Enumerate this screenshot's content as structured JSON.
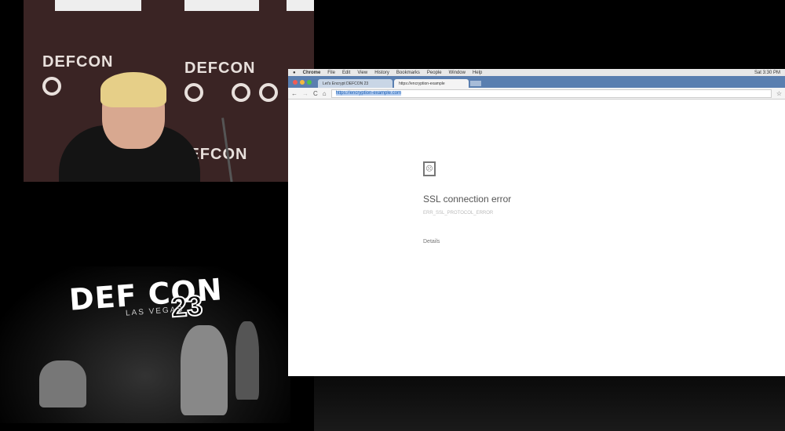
{
  "backdrop": {
    "word": "DEFCON"
  },
  "logo": {
    "title": "DEF CON",
    "number": "23",
    "subtitle": "LAS VEGAS"
  },
  "menubar": {
    "apple": "",
    "items": [
      "Chrome",
      "File",
      "Edit",
      "View",
      "History",
      "Bookmarks",
      "People",
      "Window",
      "Help"
    ],
    "clock": "Sat 3:30 PM"
  },
  "tabs": [
    {
      "label": "Let's Encrypt DEFCON 23"
    },
    {
      "label": "https://encryption-example"
    }
  ],
  "toolbar": {
    "back": "←",
    "forward": "→",
    "reload": "C",
    "home": "⌂",
    "url_scheme": "https://",
    "url_host": "encryption-example.com",
    "star": "☆"
  },
  "error": {
    "title": "SSL connection error",
    "code": "ERR_SSL_PROTOCOL_ERROR",
    "details": "Details"
  }
}
